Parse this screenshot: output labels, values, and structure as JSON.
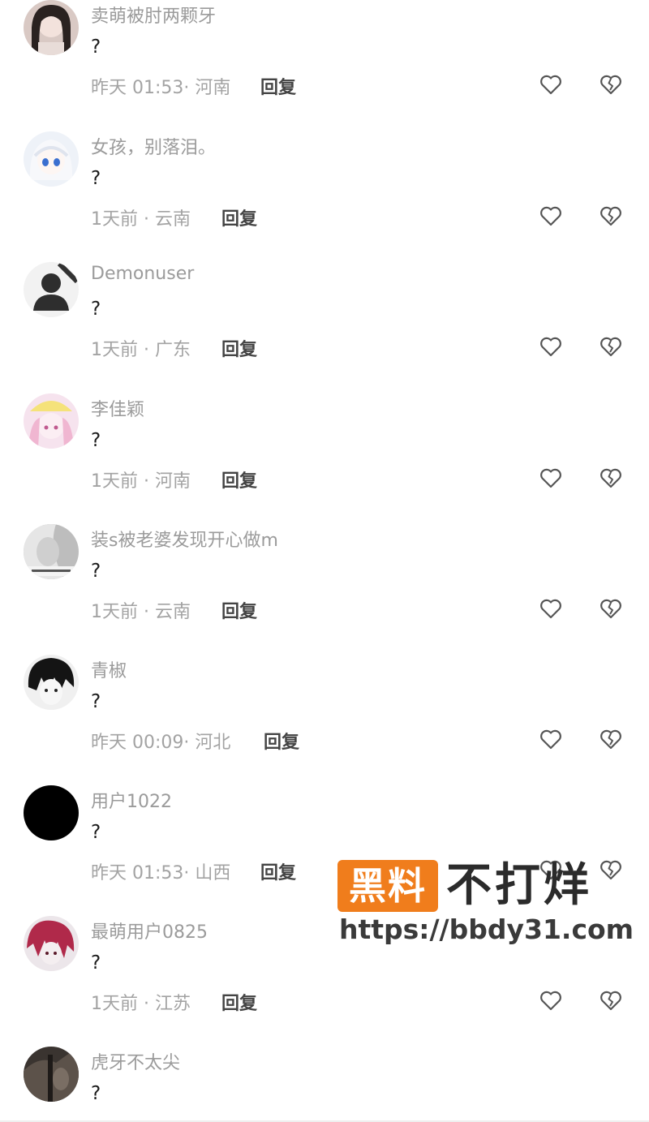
{
  "comments": [
    {
      "username": "卖萌被肘两颗牙",
      "text": "?",
      "time": "昨天 01:53",
      "location": "河南",
      "meta": "昨天 01:53· 河南",
      "reply_label": "回复",
      "avatar": "girl-photo-avatar"
    },
    {
      "username": "女孩，别落泪。",
      "text": "?",
      "time": "1天前",
      "location": "云南",
      "meta": "1天前 · 云南",
      "reply_label": "回复",
      "avatar": "anime-girl-white-hair-avatar"
    },
    {
      "username": "Demonuser",
      "text": "?",
      "time": "1天前",
      "location": "广东",
      "meta": "1天前 · 广东",
      "reply_label": "回复",
      "avatar": "default-user-avatar"
    },
    {
      "username": "李佳颖",
      "text": "?",
      "time": "1天前",
      "location": "河南",
      "meta": "1天前 · 河南",
      "reply_label": "回复",
      "avatar": "anime-pink-avatar"
    },
    {
      "username": "装s被老婆发现开心做m",
      "text": "?",
      "time": "1天前",
      "location": "云南",
      "meta": "1天前 · 云南",
      "reply_label": "回复",
      "avatar": "grayscale-face-avatar"
    },
    {
      "username": "青椒",
      "text": "?",
      "time": "昨天 00:09",
      "location": "河北",
      "meta": "昨天 00:09· 河北",
      "reply_label": "回复",
      "avatar": "anime-boy-dark-avatar"
    },
    {
      "username": "用户1022",
      "text": "?",
      "time": "昨天 01:53",
      "location": "山西",
      "meta": "昨天 01:53· 山西",
      "reply_label": "回复",
      "avatar": "black-avatar"
    },
    {
      "username": "最萌用户0825",
      "text": "?",
      "time": "1天前",
      "location": "江苏",
      "meta": "1天前 · 江苏",
      "reply_label": "回复",
      "avatar": "anime-red-hair-avatar"
    },
    {
      "username": "虎牙不太尖",
      "text": "?",
      "avatar": "dark-photo-avatar"
    }
  ],
  "watermark": {
    "box_text": "黑料",
    "big_text": "不打烊",
    "url": "https://bbdy31.com"
  },
  "colors": {
    "username": "#9b9b9b",
    "meta": "#a3a3a3",
    "reply": "#444444",
    "icon_stroke": "#555555",
    "watermark_orange": "#f07d1c"
  },
  "icons": {
    "like": "heart-outline-icon",
    "dislike": "broken-heart-icon"
  }
}
